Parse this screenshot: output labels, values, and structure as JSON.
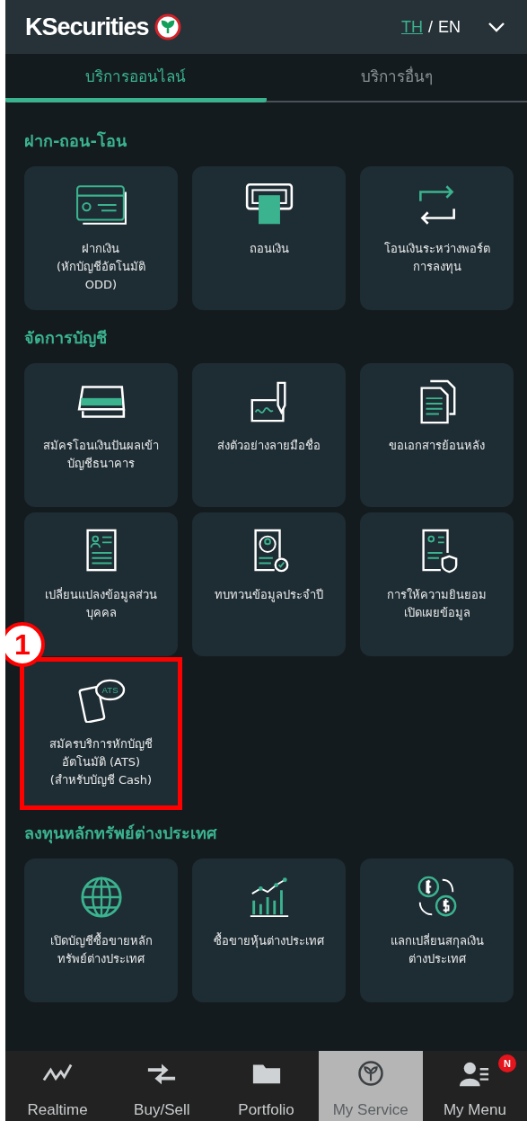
{
  "header": {
    "brand": "KSecurities",
    "languages": [
      {
        "label": "TH",
        "selected": true
      },
      {
        "label": "EN",
        "selected": false
      }
    ],
    "separator": "/"
  },
  "tabs": [
    {
      "label": "บริการออนไลน์",
      "selected": true
    },
    {
      "label": "บริการอื่นๆ",
      "selected": false
    }
  ],
  "sections": [
    {
      "title": "ฝาก-ถอน-โอน",
      "tiles": [
        {
          "label": "ฝากเงิน\n(หักบัญชีอัตโนมัติ\nODD)",
          "kind": "card",
          "highlighted": false
        },
        {
          "label": "ถอนเงิน",
          "kind": "atm",
          "highlighted": false
        },
        {
          "label": "โอนเงินระหว่างพอร์ต\nการลงทุน",
          "kind": "transfer",
          "highlighted": false
        }
      ]
    },
    {
      "title": "จัดการบัญชี",
      "tiles": [
        {
          "label": "สมัครโอนเงินปันผลเข้า\nบัญชีธนาคาร",
          "kind": "bankcard",
          "highlighted": false
        },
        {
          "label": "ส่งตัวอย่างลายมือชื่อ",
          "kind": "signature",
          "highlighted": false
        },
        {
          "label": "ขอเอกสารย้อนหลัง",
          "kind": "documents",
          "highlighted": false
        },
        {
          "label": "เปลี่ยนแปลงข้อมูลส่วน\nบุคคล",
          "kind": "profile",
          "highlighted": false
        },
        {
          "label": "ทบทวนข้อมูลประจำปี",
          "kind": "review",
          "highlighted": false
        },
        {
          "label": "การให้ความยินยอม\nเปิดเผยข้อมูล",
          "kind": "consent",
          "highlighted": false
        },
        {
          "label": "สมัครบริการหักบัญชี\nอัตโนมัติ (ATS)\n(สำหรับบัญชี Cash)",
          "kind": "ats",
          "highlighted": true,
          "callout": "1",
          "icon_text": "ATS"
        }
      ]
    },
    {
      "title": "ลงทุนหลักทรัพย์ต่างประเทศ",
      "tiles": [
        {
          "label": "เปิดบัญชีซื้อขายหลัก\nทรัพย์ต่างประเทศ",
          "kind": "globe",
          "highlighted": false
        },
        {
          "label": "ซื้อขายหุ้นต่างประเทศ",
          "kind": "chart",
          "highlighted": false
        },
        {
          "label": "แลกเปลี่ยนสกุลเงิน\nต่างประเทศ",
          "kind": "exchange",
          "highlighted": false
        }
      ]
    }
  ],
  "nav": [
    {
      "label": "Realtime",
      "kind": "pulse",
      "selected": false
    },
    {
      "label": "Buy/Sell",
      "kind": "arrows",
      "selected": false
    },
    {
      "label": "Portfolio",
      "kind": "folder",
      "selected": false
    },
    {
      "label": "My Service",
      "kind": "leaf",
      "selected": true
    },
    {
      "label": "My Menu",
      "kind": "person",
      "selected": false,
      "badge": "N"
    }
  ]
}
